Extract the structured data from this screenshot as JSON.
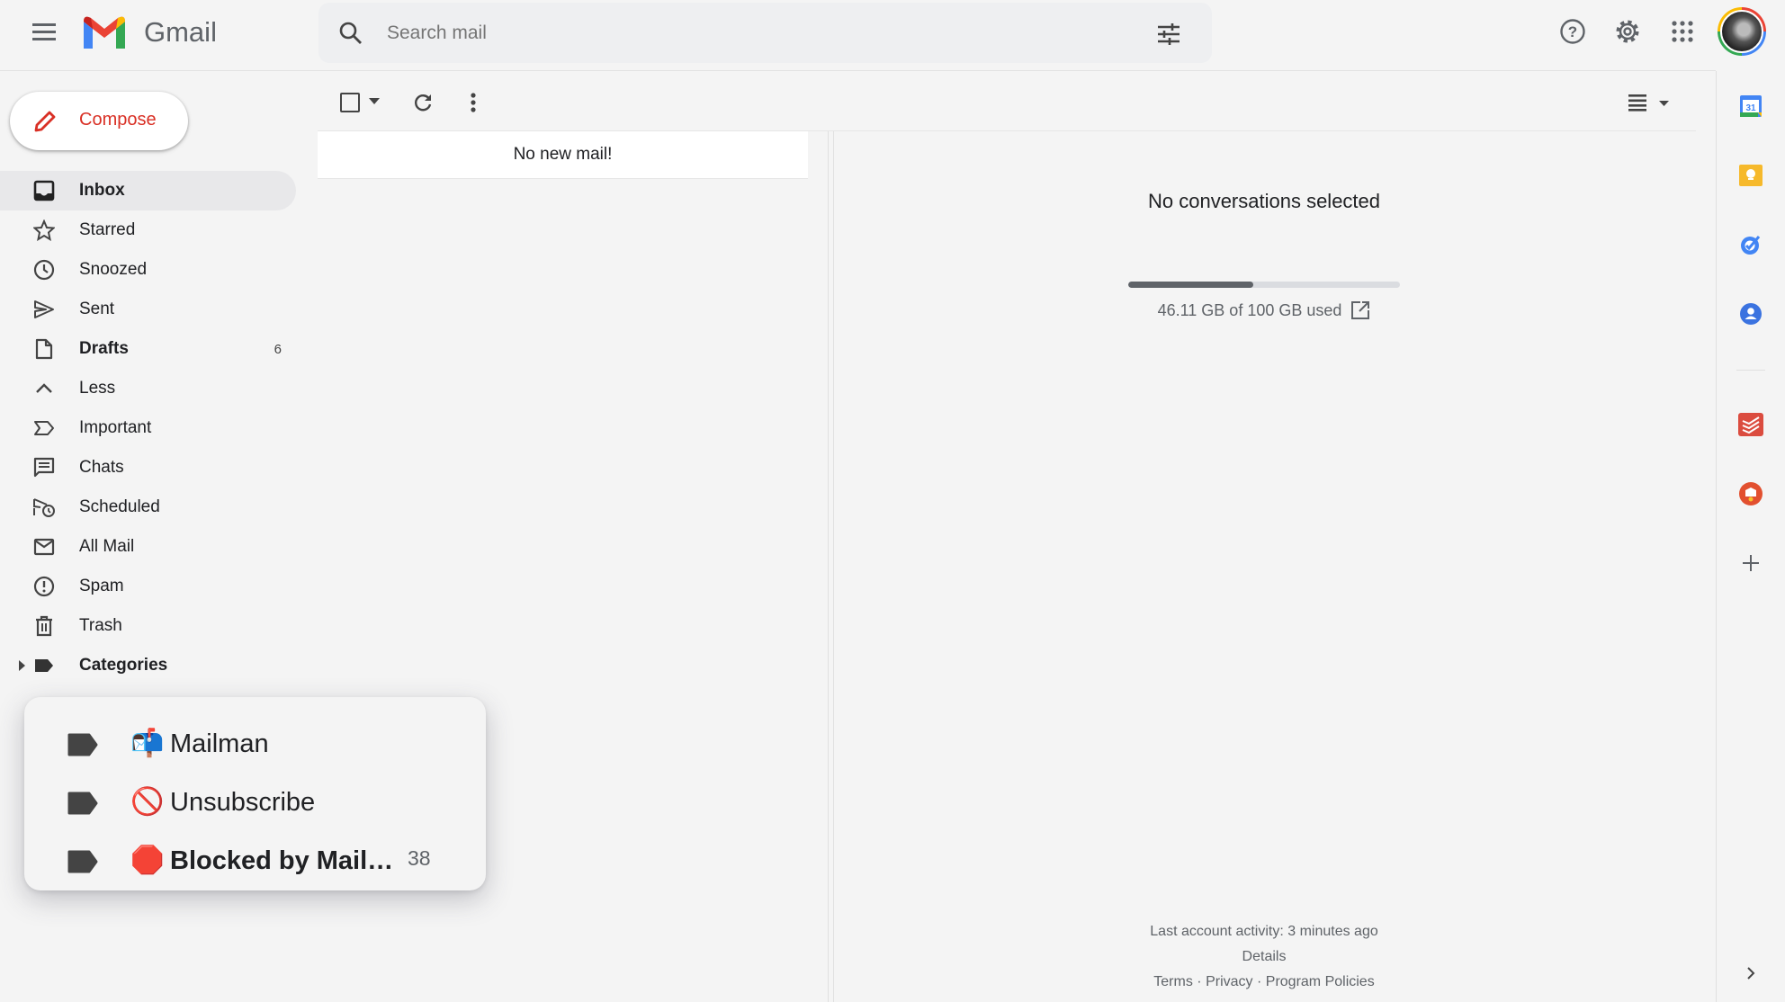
{
  "header": {
    "app_name": "Gmail",
    "search_placeholder": "Search mail"
  },
  "compose": {
    "label": "Compose"
  },
  "sidebar": {
    "items": [
      {
        "label": "Inbox",
        "icon": "inbox-icon",
        "active": true,
        "bold": true
      },
      {
        "label": "Starred",
        "icon": "star-icon"
      },
      {
        "label": "Snoozed",
        "icon": "clock-icon"
      },
      {
        "label": "Sent",
        "icon": "send-icon"
      },
      {
        "label": "Drafts",
        "icon": "draft-icon",
        "bold": true,
        "count": "6"
      },
      {
        "label": "Less",
        "icon": "chevron-up-icon"
      },
      {
        "label": "Important",
        "icon": "important-icon"
      },
      {
        "label": "Chats",
        "icon": "chat-icon"
      },
      {
        "label": "Scheduled",
        "icon": "scheduled-icon"
      },
      {
        "label": "All Mail",
        "icon": "mail-icon"
      },
      {
        "label": "Spam",
        "icon": "spam-icon"
      },
      {
        "label": "Trash",
        "icon": "trash-icon"
      },
      {
        "label": "Categories",
        "icon": "label-icon",
        "bold": true
      }
    ]
  },
  "labels_popup": {
    "items": [
      {
        "emoji": "📬",
        "label": "Mailman"
      },
      {
        "emoji": "🚫",
        "label": "Unsubscribe"
      },
      {
        "emoji": "🛑",
        "label": "Blocked by Mail…",
        "count": "38",
        "bold": true
      }
    ]
  },
  "list": {
    "empty_message": "No new mail!"
  },
  "reading_pane": {
    "empty_title": "No conversations selected",
    "storage_text": "46.11 GB of 100 GB used",
    "storage_used_fraction": 0.4611,
    "last_activity": "Last account activity: 3 minutes ago",
    "details_link": "Details",
    "footer_links": [
      "Terms",
      "Privacy",
      "Program Policies"
    ],
    "footer_separator": "·"
  },
  "colors": {
    "compose_text": "#d93025",
    "storage_fill": "#5f6368",
    "storage_track": "#dadce0",
    "active_nav": "#e8e8ea"
  }
}
